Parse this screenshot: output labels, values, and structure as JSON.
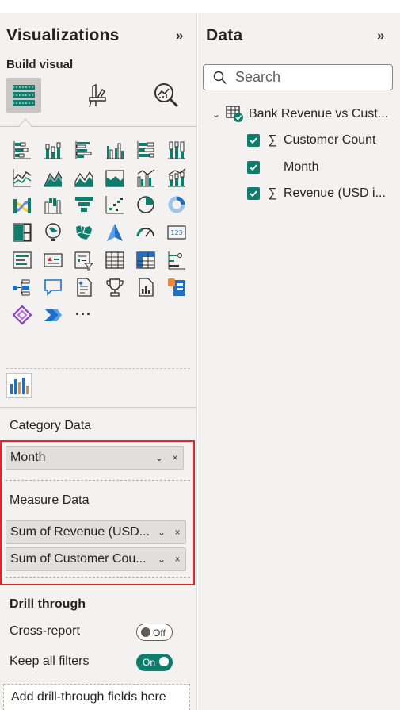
{
  "visualizations": {
    "title": "Visualizations",
    "collapse_glyph": "»",
    "build_label": "Build visual",
    "tabs": [
      "build-visual-tab",
      "format-visual-tab",
      "analytics-tab"
    ],
    "visual_icons": [
      [
        "stacked-bar-icon",
        "stacked-column-icon",
        "clustered-bar-icon",
        "clustered-column-icon",
        "100-stacked-bar-icon",
        "100-stacked-column-icon"
      ],
      [
        "line-chart-icon",
        "area-chart-icon",
        "stacked-area-icon",
        "100-stacked-area-icon",
        "line-clustered-column-icon",
        "line-stacked-column-icon"
      ],
      [
        "ribbon-chart-icon",
        "waterfall-chart-icon",
        "funnel-chart-icon",
        "scatter-chart-icon",
        "pie-chart-icon",
        "donut-chart-icon"
      ],
      [
        "treemap-icon",
        "map-icon",
        "filled-map-icon",
        "azure-map-icon",
        "gauge-icon",
        "card-icon"
      ],
      [
        "multi-row-card-icon",
        "kpi-icon",
        "slicer-icon",
        "table-icon",
        "matrix-icon",
        "key-influencers-icon"
      ],
      [
        "decomposition-tree-icon",
        "qa-icon",
        "smart-narrative-icon",
        "metrics-icon",
        "paginated-report-icon",
        "power-apps-icon"
      ],
      [
        "power-automate-icon",
        "power-automate-flow-icon",
        "more-visuals-icon"
      ]
    ],
    "more_label": "···",
    "category_label": "Category Data",
    "category_fields": [
      "Month"
    ],
    "measure_label": "Measure Data",
    "measure_fields": [
      "Sum of Revenue (USD...",
      "Sum of Customer Cou..."
    ],
    "chip_chevron": "⌄",
    "chip_remove": "×",
    "drill_title": "Drill through",
    "cross_report_label": "Cross-report",
    "cross_report_state": "Off",
    "keep_filters_label": "Keep all filters",
    "keep_filters_state": "On",
    "drill_add": "Add drill-through fields here"
  },
  "data_pane": {
    "title": "Data",
    "collapse_glyph": "»",
    "search_placeholder": "Search",
    "table_chevron": "⌄",
    "table_name": "Bank Revenue vs Cust...",
    "fields": [
      {
        "name": "Customer Count",
        "checked": true,
        "sigma": "∑"
      },
      {
        "name": "Month",
        "checked": true,
        "sigma": ""
      },
      {
        "name": "Revenue (USD i...",
        "checked": true,
        "sigma": "∑"
      }
    ]
  },
  "colors": {
    "accent_teal": "#107c6c",
    "highlight_red": "#e3242b",
    "pane_bg": "#f3f2f1",
    "chip_bg": "#e1dfdd"
  }
}
